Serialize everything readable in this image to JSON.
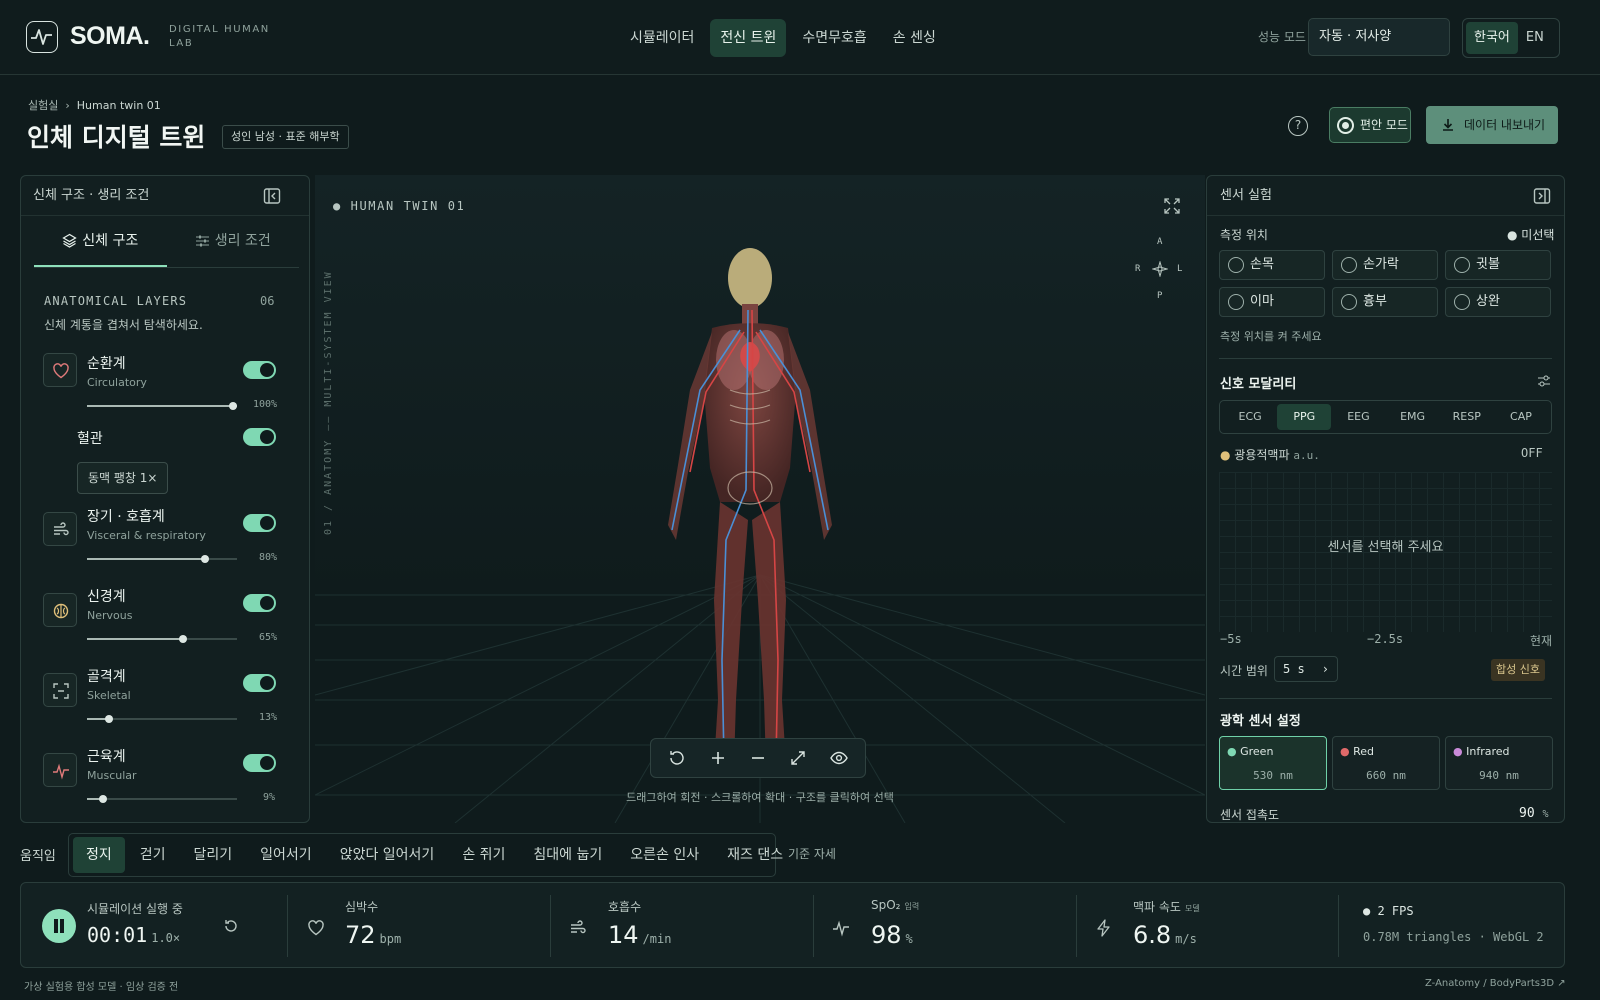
{
  "brand": {
    "name": "SOMA.",
    "tagline_line1": "DIGITAL HUMAN",
    "tagline_line2": "LAB"
  },
  "nav": [
    {
      "label": "시뮬레이터",
      "active": false
    },
    {
      "label": "전신 트윈",
      "active": true
    },
    {
      "label": "수면무호흡",
      "active": false
    },
    {
      "label": "손 센싱",
      "active": false
    }
  ],
  "perf": {
    "label": "성능 모드",
    "value": "자동 · 저사양"
  },
  "lang": {
    "ko": "한국어",
    "en": "EN"
  },
  "breadcrumb": {
    "root": "실험실",
    "sep": "›",
    "current": "Human twin 01"
  },
  "page": {
    "title": "인체 디지털 트윈",
    "chip": "성인 남성 · 표준 해부학",
    "help": "?",
    "comfort_mode": "편안 모드",
    "export": "데이터 내보내기"
  },
  "left_panel": {
    "header": "신체 구조 · 생리 조건",
    "tabs": [
      "신체 구조",
      "생리 조건"
    ],
    "layers_title": "ANATOMICAL LAYERS",
    "layers_count": "06",
    "layers_desc": "신체 계통을 겹쳐서 탐색하세요.",
    "layers": [
      {
        "name": "순환계",
        "sub": "Circulatory",
        "pct": "100%",
        "value": 1.0,
        "icon": "heart-icon"
      },
      {
        "name": "장기 · 호흡계",
        "sub": "Visceral & respiratory",
        "pct": "80%",
        "value": 0.8,
        "icon": "wind-icon"
      },
      {
        "name": "신경계",
        "sub": "Nervous",
        "pct": "65%",
        "value": 0.65,
        "icon": "brain-icon"
      },
      {
        "name": "골격계",
        "sub": "Skeletal",
        "pct": "13%",
        "value": 0.13,
        "icon": "scan-icon"
      },
      {
        "name": "근육계",
        "sub": "Muscular",
        "pct": "9%",
        "value": 0.09,
        "icon": "pulse-icon"
      }
    ],
    "vessel": {
      "name": "혈관",
      "chip": "동맥 팽창 1×"
    }
  },
  "viewport": {
    "label": "HUMAN TWIN 01",
    "vertical": "01 / ANATOMY —— MULTI-SYSTEM VIEW",
    "compass": {
      "a": "A",
      "p": "P",
      "r": "R",
      "l": "L"
    },
    "hint": "드래그하여 회전   ·   스크롤하여 확대   ·   구조를 클릭하여 선택"
  },
  "right_panel": {
    "header": "센서 실험",
    "measure_label": "측정 위치",
    "measure_status": "● 미선택",
    "sites": [
      "손목",
      "손가락",
      "귓볼",
      "이마",
      "흉부",
      "상완"
    ],
    "site_hint": "측정 위치를 켜 주세요",
    "modality_title": "신호 모달리티",
    "modalities": [
      "ECG",
      "PPG",
      "EEG",
      "EMG",
      "RESP",
      "CAP"
    ],
    "active_modality": "PPG",
    "signal_name": "광용적맥파",
    "signal_unit": "a.u.",
    "signal_state": "OFF",
    "chart_message": "센서를 선택해 주세요",
    "time_ticks": [
      "−5s",
      "−2.5s",
      "현재"
    ],
    "range_label": "시간 범위",
    "range_value": "5 s",
    "synthetic": "합성 신호",
    "optical_title": "광학 센서 설정",
    "wavelengths": [
      {
        "name": "Green",
        "nm": "530 nm",
        "color": "#7fd8b3"
      },
      {
        "name": "Red",
        "nm": "660 nm",
        "color": "#e06a6a"
      },
      {
        "name": "Infrared",
        "nm": "940 nm",
        "color": "#c98ad8"
      }
    ],
    "contact_label": "센서 접촉도",
    "contact_value": "90",
    "contact_unit": "%"
  },
  "motion": {
    "label": "움직임",
    "items": [
      "정지",
      "걷기",
      "달리기",
      "일어서기",
      "앉았다 일어서기",
      "손 쥐기",
      "침대에 눕기",
      "오른손 인사",
      "재즈 댄스"
    ],
    "active": "정지",
    "base_pose": "기준 자세"
  },
  "status": {
    "sim_label": "시뮬레이션 실행 중",
    "time": "00:01",
    "speed": "1.0×",
    "hr_label": "심박수",
    "hr_value": "72",
    "hr_unit": "bpm",
    "rr_label": "호흡수",
    "rr_value": "14",
    "rr_unit": "/min",
    "spo2_label": "SpO₂",
    "spo2_tag": "입력",
    "spo2_value": "98",
    "spo2_unit": "%",
    "pwv_label": "맥파 속도",
    "pwv_tag": "모델",
    "pwv_value": "6.8",
    "pwv_unit": "m/s",
    "fps": "● 2 FPS",
    "render_info": "0.78M triangles · WebGL 2"
  },
  "footer": {
    "left": "가상 실험용 합성 모델 · 임상 검증 전",
    "right": "Z-Anatomy / BodyParts3D ↗"
  },
  "colors": {
    "accent": "#8ee0bb",
    "active_bg": "#1f4236",
    "bg": "#0f1b1c",
    "artery": "#d64545",
    "vein": "#4a8fd6"
  }
}
